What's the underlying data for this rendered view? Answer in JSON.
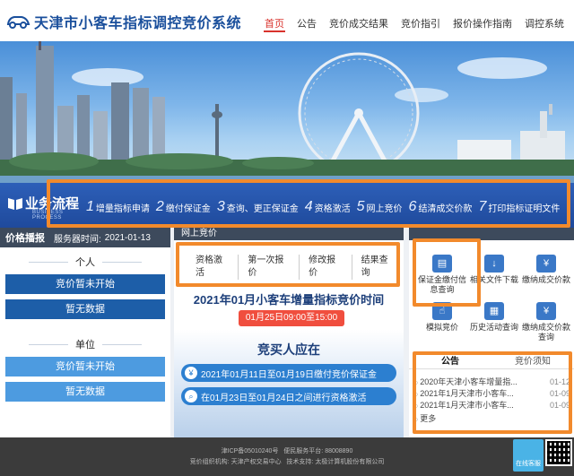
{
  "header": {
    "title": "天津市小客车指标调控竞价系统",
    "nav": [
      "首页",
      "公告",
      "竞价成交结果",
      "竞价指引",
      "报价操作指南",
      "调控系统"
    ]
  },
  "process": {
    "label_zh": "业务流程",
    "label_en": "BUSINESS PROCESS",
    "steps": [
      {
        "num": "1",
        "text": "增量指标申请"
      },
      {
        "num": "2",
        "text": "缴付保证金"
      },
      {
        "num": "3",
        "text": "查询、更正保证金"
      },
      {
        "num": "4",
        "text": "资格激活"
      },
      {
        "num": "5",
        "text": "网上竞价"
      },
      {
        "num": "6",
        "text": "结清成交价款"
      },
      {
        "num": "7",
        "text": "打印指标证明文件"
      }
    ]
  },
  "left": {
    "head_title": "价格播报",
    "server_time_label": "服务器时间:",
    "server_time": "2021-01-13",
    "personal": {
      "title": "个人",
      "status": "竞价暂未开始",
      "data": "暂无数据"
    },
    "company": {
      "title": "单位",
      "status": "竞价暂未开始",
      "data": "暂无数据"
    }
  },
  "center": {
    "head_title": "网上竞价",
    "tabs": [
      "资格激活",
      "第一次报价",
      "修改报价",
      "结果查询"
    ],
    "bid_title": "2021年01月小客车增量指标竞价时间",
    "bid_time": "01月25日09:00至15:00",
    "buyer_title": "竞买人应在",
    "notice1": "2021年01月11日至01月19日缴付竞价保证金",
    "notice2": "在01月23日至01月24日之间进行资格激活"
  },
  "right": {
    "services": [
      {
        "icon": "deposit-info-icon",
        "label": "保证金缴付信息查询"
      },
      {
        "icon": "download-icon",
        "label": "相关文件下载"
      },
      {
        "icon": "payment-icon",
        "label": "缴纳成交价款"
      },
      {
        "icon": "mock-bid-icon",
        "label": "模拟竞价"
      },
      {
        "icon": "history-icon",
        "label": "历史活动查询"
      },
      {
        "icon": "payment-query-icon",
        "label": "缴纳成交价款查询"
      }
    ],
    "news_tabs": [
      "公告",
      "竞价须知"
    ],
    "news": [
      {
        "title": "2020年天津小客车增量指...",
        "date": "01-12"
      },
      {
        "title": "2021年1月天津市小客车...",
        "date": "01-09"
      },
      {
        "title": "2021年1月天津市小客车...",
        "date": "01-09"
      }
    ],
    "more": "更多"
  },
  "footer": {
    "icp": "津ICP备05010240号",
    "phone_label": "便民服务平台:",
    "phone": "88008890",
    "org_label": "竞价组织机构:",
    "org": "天津产权交易中心",
    "tech_label": "技术支持:",
    "tech": "太极计算机股份有限公司",
    "online": "在线客服"
  },
  "colors": {
    "brand": "#1a4f9c",
    "accent": "#d9322c",
    "highlight": "#f28a2c",
    "button": "#1d5ea8"
  }
}
